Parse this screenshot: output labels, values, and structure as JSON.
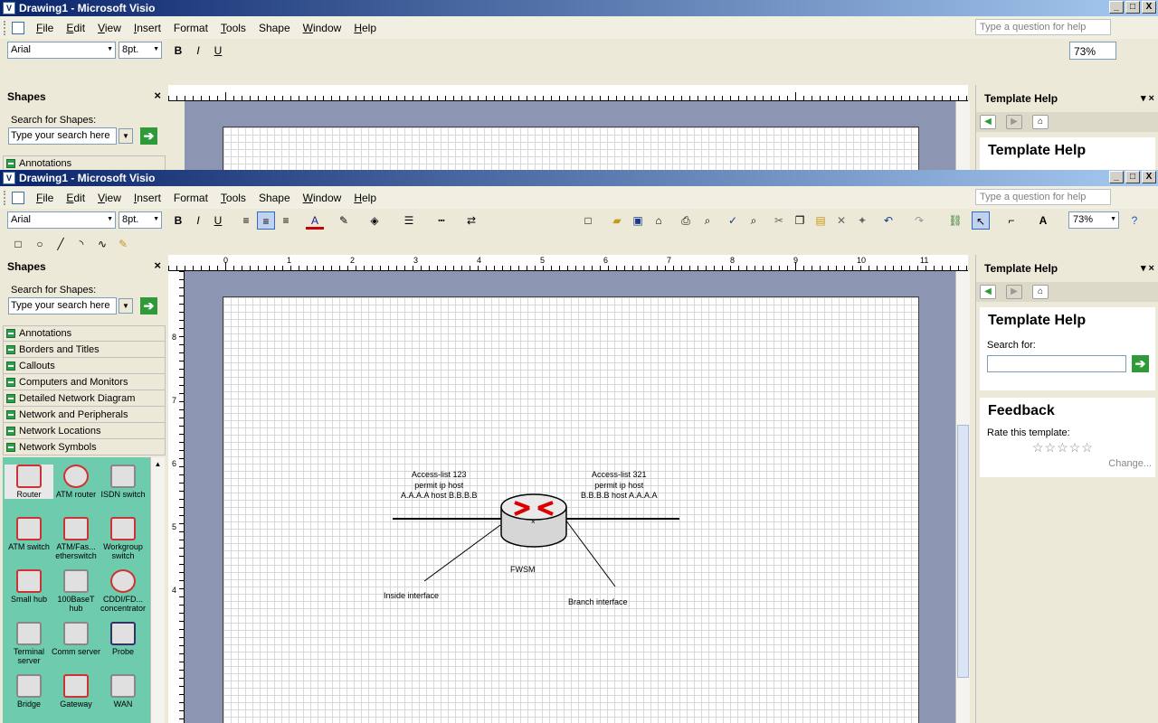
{
  "title": "Drawing1 - Microsoft Visio",
  "caption_buttons": {
    "minimize": "_",
    "maximize": "□",
    "close": "X"
  },
  "menu": [
    {
      "key": "F",
      "rest": "ile"
    },
    {
      "key": "E",
      "rest": "dit"
    },
    {
      "key": "V",
      "rest": "iew"
    },
    {
      "key": "I",
      "rest": "nsert"
    },
    {
      "key": "",
      "rest": "Format"
    },
    {
      "key": "T",
      "rest": "ools"
    },
    {
      "key": "",
      "rest": "Shape"
    },
    {
      "key": "W",
      "rest": "indow"
    },
    {
      "key": "H",
      "rest": "elp"
    }
  ],
  "help_placeholder": "Type a question for help",
  "formatting": {
    "font": "Arial",
    "size": "8pt.",
    "bold": "B",
    "italic": "I",
    "underline": "U",
    "font_color": "A"
  },
  "zoom": "73%",
  "shapes_pane": {
    "title": "Shapes",
    "close": "×",
    "search_label": "Search for Shapes:",
    "search_placeholder": "Type your search here",
    "go": "➔",
    "stencils": [
      "Annotations",
      "Borders and Titles",
      "Callouts",
      "Computers and Monitors",
      "Detailed Network Diagram",
      "Network and Peripherals",
      "Network Locations",
      "Network Symbols"
    ],
    "masters": [
      {
        "label": "Router",
        "icon": "router-icon",
        "selected": true
      },
      {
        "label": "ATM router",
        "icon": "atm-router-icon"
      },
      {
        "label": "ISDN switch",
        "icon": "isdn-switch-icon"
      },
      {
        "label": "ATM switch",
        "icon": "atm-switch-icon"
      },
      {
        "label": "ATM/Fas... etherswitch",
        "icon": "etherswitch-icon"
      },
      {
        "label": "Workgroup switch",
        "icon": "workgroup-switch-icon"
      },
      {
        "label": "Small hub",
        "icon": "small-hub-icon"
      },
      {
        "label": "100BaseT hub",
        "icon": "hub-icon"
      },
      {
        "label": "CDDI/FD... concentrator",
        "icon": "concentrator-icon"
      },
      {
        "label": "Terminal server",
        "icon": "terminal-server-icon"
      },
      {
        "label": "Comm server",
        "icon": "comm-server-icon"
      },
      {
        "label": "Probe",
        "icon": "probe-icon"
      },
      {
        "label": "Bridge",
        "icon": "bridge-icon"
      },
      {
        "label": "Gateway",
        "icon": "gateway-icon"
      },
      {
        "label": "WAN",
        "icon": "wan-icon"
      }
    ]
  },
  "ruler": {
    "h_numbers": [
      "0",
      "1",
      "2",
      "3",
      "4",
      "5",
      "6",
      "7",
      "8",
      "9",
      "10",
      "11"
    ],
    "v_numbers": [
      "8",
      "7",
      "6",
      "5",
      "4"
    ]
  },
  "diagram": {
    "acl_left": [
      "Access-list 123",
      "permit ip host",
      "A.A.A.A host B.B.B.B"
    ],
    "acl_right": [
      "Access-list 321",
      "permit ip  host",
      "B.B.B.B host A.A.A.A"
    ],
    "device_label": "FWSM",
    "inside_label": "Inside interface",
    "branch_label": "Branch interface"
  },
  "help_pane": {
    "title": "Template Help",
    "heading": "Template Help",
    "search_label": "Search for:",
    "feedback_heading": "Feedback",
    "rate_label": "Rate this template:",
    "stars": "☆☆☆☆☆",
    "change_link": "Change..."
  },
  "colors": {
    "title_start": "#0a246a",
    "title_end": "#a6caf0",
    "palette_bg": "#6ecbad",
    "canvas_bg": "#8c96b3"
  }
}
